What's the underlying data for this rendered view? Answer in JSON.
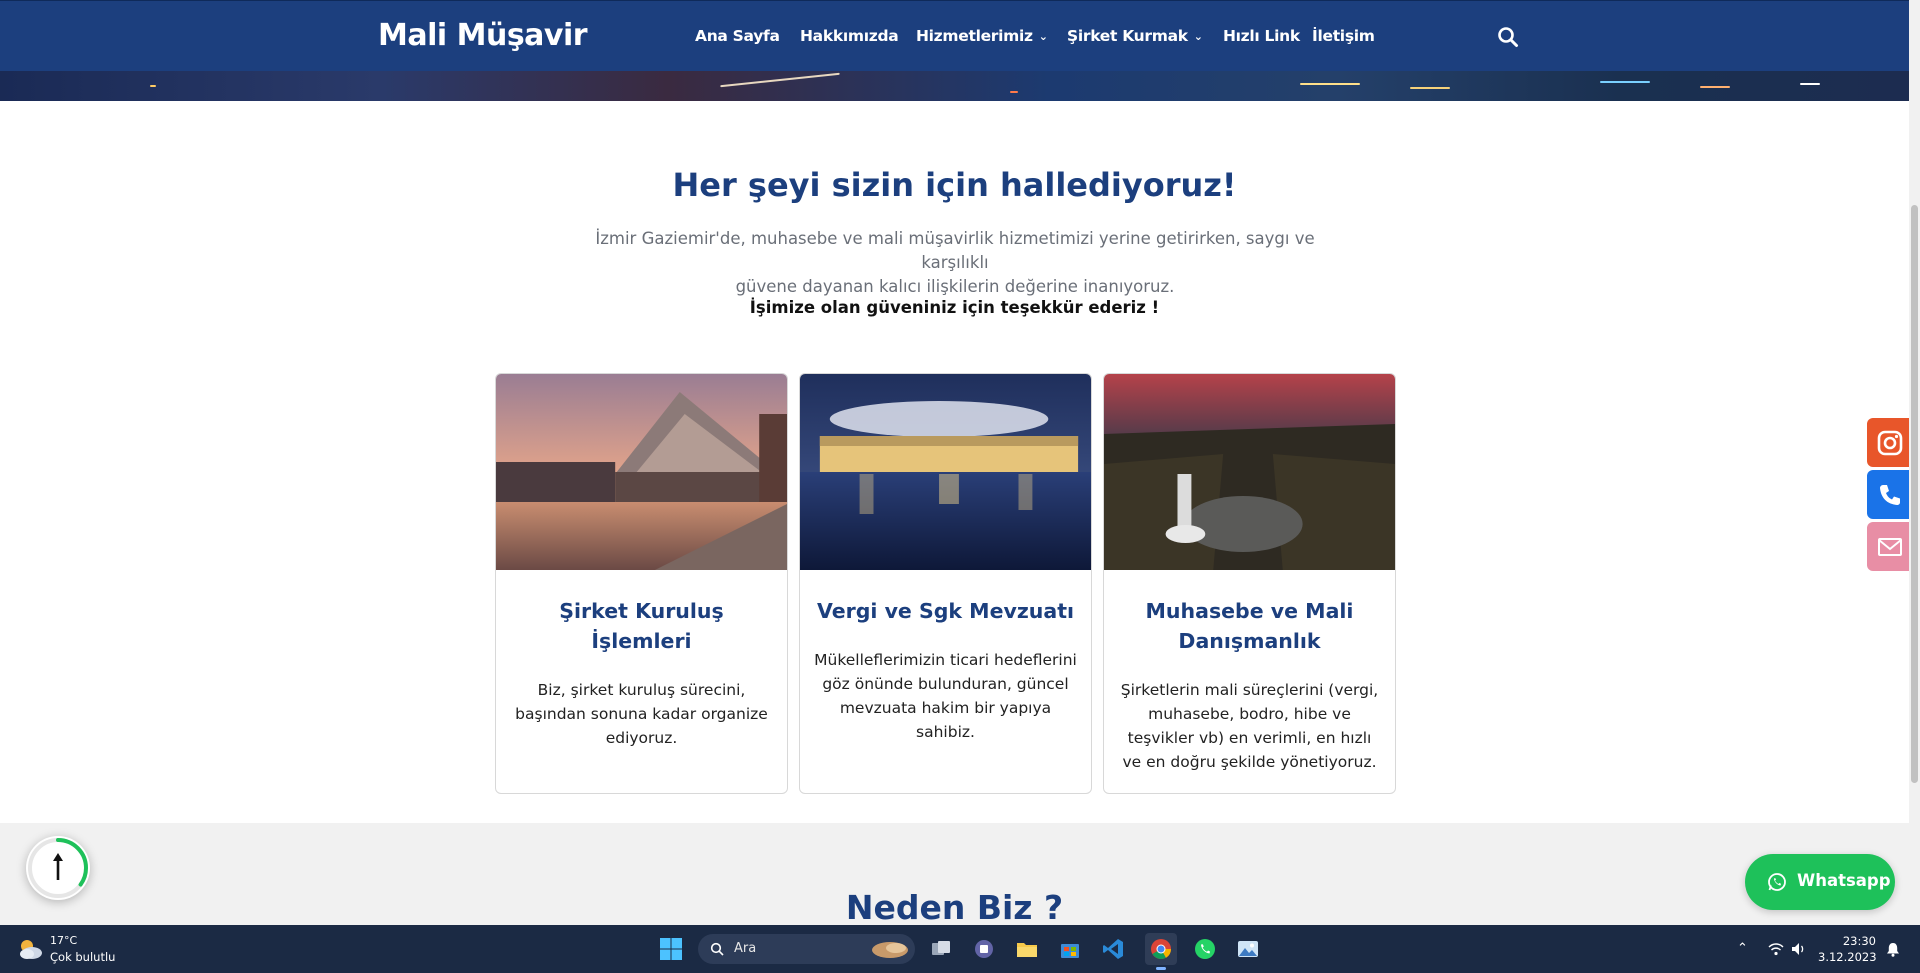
{
  "header": {
    "logo": "Mali Müşavir",
    "nav": [
      {
        "label": "Ana Sayfa",
        "dropdown": false
      },
      {
        "label": "Hakkımızda",
        "dropdown": false
      },
      {
        "label": "Hizmetlerimiz",
        "dropdown": true
      },
      {
        "label": "Şirket Kurmak",
        "dropdown": true
      },
      {
        "label": "Hızlı Link",
        "dropdown": false
      },
      {
        "label": "İletişim",
        "dropdown": false
      }
    ],
    "search_icon": "search-icon"
  },
  "intro": {
    "title": "Her şeyi sizin için hallediyoruz!",
    "paragraph_line1": "İzmir Gaziemir'de, muhasebe ve mali müşavirlik hizmetimizi yerine getirirken, saygı ve karşılıklı",
    "paragraph_line2": "güvene dayanan kalıcı ilişkilerin değerine inanıyoruz.",
    "strong": "İşimize olan güveniniz için teşekkür ederiz !"
  },
  "cards": [
    {
      "title": "Şirket Kuruluş İşlemleri",
      "text": "Biz, şirket kuruluş sürecini, başından sonuna kadar organize ediyoruz."
    },
    {
      "title": "Vergi ve Sgk Mevzuatı",
      "text": "Mükelleflerimizin ticari hedeflerini göz önünde bulunduran, güncel mevzuata hakim bir yapıya sahibiz."
    },
    {
      "title": "Muhasebe ve Mali Danışmanlık",
      "text": "Şirketlerin mali süreçlerini (vergi, muhasebe, bodro, hibe ve teşvikler vb) en verimli, en hızlı ve en doğru şekilde yönetiyoruz."
    }
  ],
  "why": {
    "title": "Neden Biz ?"
  },
  "widgets": {
    "whatsapp_label": "Whatsapp",
    "scroll_progress": 0.35,
    "side_buttons": [
      "instagram-icon",
      "phone-icon",
      "mail-icon"
    ]
  },
  "taskbar": {
    "weather_temp": "17°C",
    "weather_desc": "Çok bulutlu",
    "search_placeholder": "Ara",
    "apps": [
      "task-view",
      "teams",
      "file-explorer",
      "microsoft-store",
      "vscode",
      "chrome",
      "whatsapp",
      "photos"
    ],
    "active_app": "chrome",
    "time": "23:30",
    "date": "3.12.2023"
  },
  "colors": {
    "brand": "#1c3f7e",
    "whatsapp": "#1ec15a",
    "instagram": "#e8562a",
    "phone": "#1a73e8",
    "mail": "#e88ea5"
  }
}
